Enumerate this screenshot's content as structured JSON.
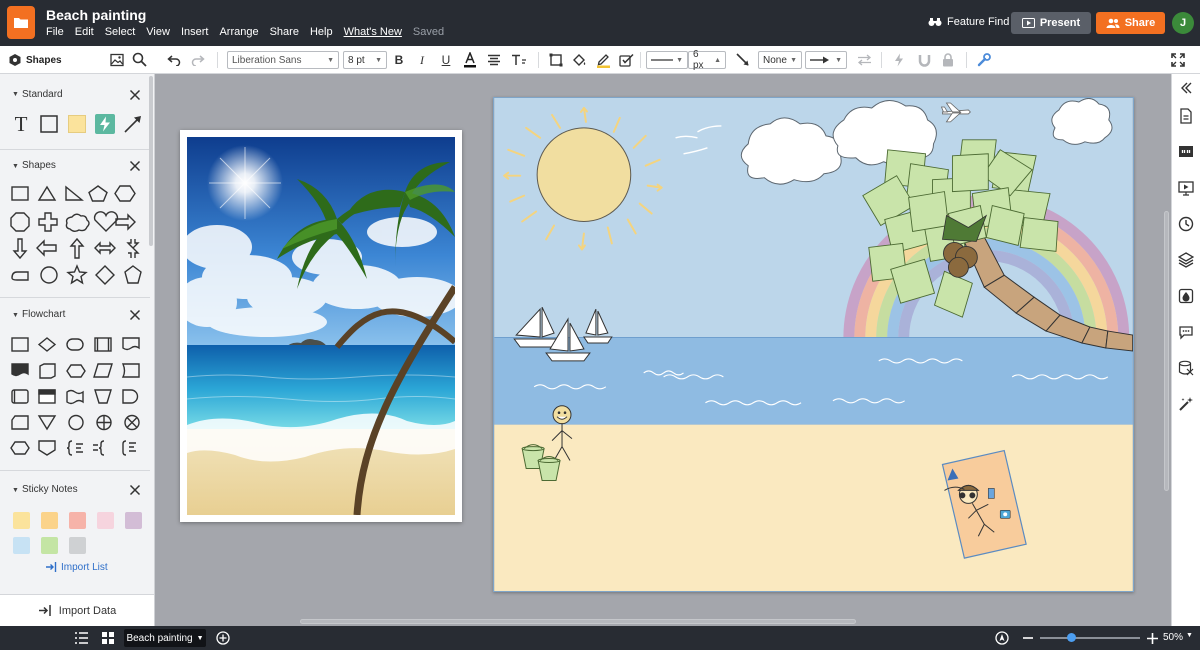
{
  "app": {
    "doc_title": "Beach painting",
    "menu": [
      "File",
      "Edit",
      "Select",
      "View",
      "Insert",
      "Arrange",
      "Share",
      "Help",
      "What's New"
    ],
    "save_status": "Saved",
    "feature_find": "Feature Find",
    "present_label": "Present",
    "share_label": "Share",
    "avatar_initial": "J",
    "accent_color": "#f37021"
  },
  "toolbar": {
    "font_family": "Liberation Sans",
    "font_size": "8 pt",
    "line_width": "6 px",
    "line_start": "None"
  },
  "left_panel": {
    "title": "Shapes",
    "sections": {
      "standard": "Standard",
      "shapes": "Shapes",
      "flowchart": "Flowchart",
      "sticky_notes": "Sticky Notes"
    },
    "sticky_colors": [
      "#fbe39c",
      "#fbd38a",
      "#f6b3a9",
      "#f6d4de",
      "#d3bdd6",
      "#c7e2f4",
      "#c4e5a4",
      "#cfd1d3"
    ],
    "import_list": "Import List",
    "import_data": "Import Data"
  },
  "bottom": {
    "page_name": "Beach painting",
    "zoom": "50%"
  }
}
